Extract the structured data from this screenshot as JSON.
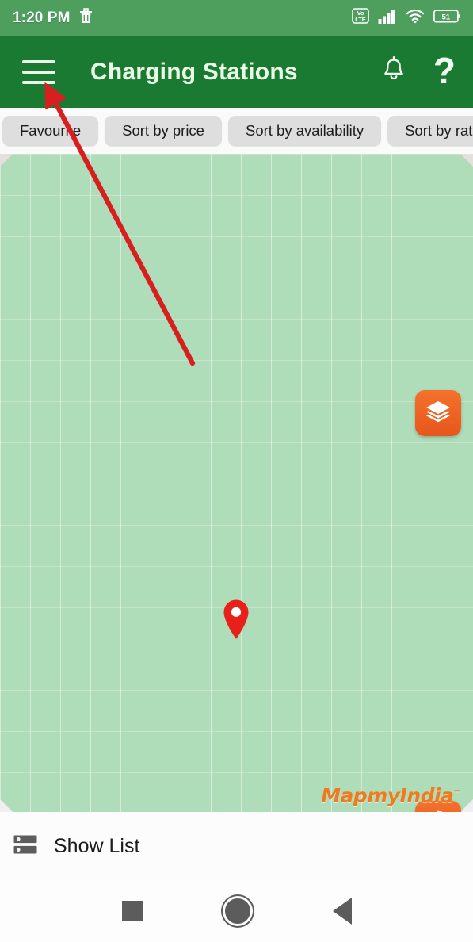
{
  "status_bar": {
    "time": "1:20 PM",
    "notification_icons": [
      "trash-icon"
    ],
    "network_label": "Vo LTE",
    "network_top": "Vo",
    "network_bottom": "LTE",
    "signal_icon": "signal-bars-icon",
    "wifi_icon": "wifi-icon",
    "battery_percent": "51",
    "background_color": "#4e9e5e"
  },
  "app_bar": {
    "menu_icon": "hamburger-menu-icon",
    "title": "Charging Stations",
    "notification_icon": "bell-icon",
    "help_label": "?",
    "background_color": "#1a7a32",
    "title_color": "#e9fbe6"
  },
  "filters": {
    "chips": [
      {
        "label": "Favourite"
      },
      {
        "label": "Sort by price"
      },
      {
        "label": "Sort by availability"
      },
      {
        "label": "Sort by rating"
      }
    ],
    "chip_background": "#dedede"
  },
  "map": {
    "background_color": "#b0ddb9",
    "marker_icon": "map-pin-marker",
    "marker_color": "#e8201a",
    "brand_label": "MapmyIndia",
    "brand_trademark": "™",
    "brand_color": "#f07a1f",
    "controls": [
      {
        "name": "layers-button",
        "icon": "layers-icon"
      },
      {
        "name": "refresh-button",
        "icon": "refresh-icon"
      },
      {
        "name": "ev-station-button",
        "icon": "ev-charging-station-icon"
      }
    ],
    "control_color": "#e8561c"
  },
  "bottom_bar": {
    "list_icon": "list-view-icon",
    "label": "Show List"
  },
  "nav_bar": {
    "recents_label": "recents-square",
    "home_label": "home-circle",
    "back_label": "back-triangle",
    "icon_color": "#5c5c5c"
  },
  "annotation": {
    "arrow_color": "#d81f1f",
    "arrow_description": "red arrow pointing to hamburger menu"
  }
}
